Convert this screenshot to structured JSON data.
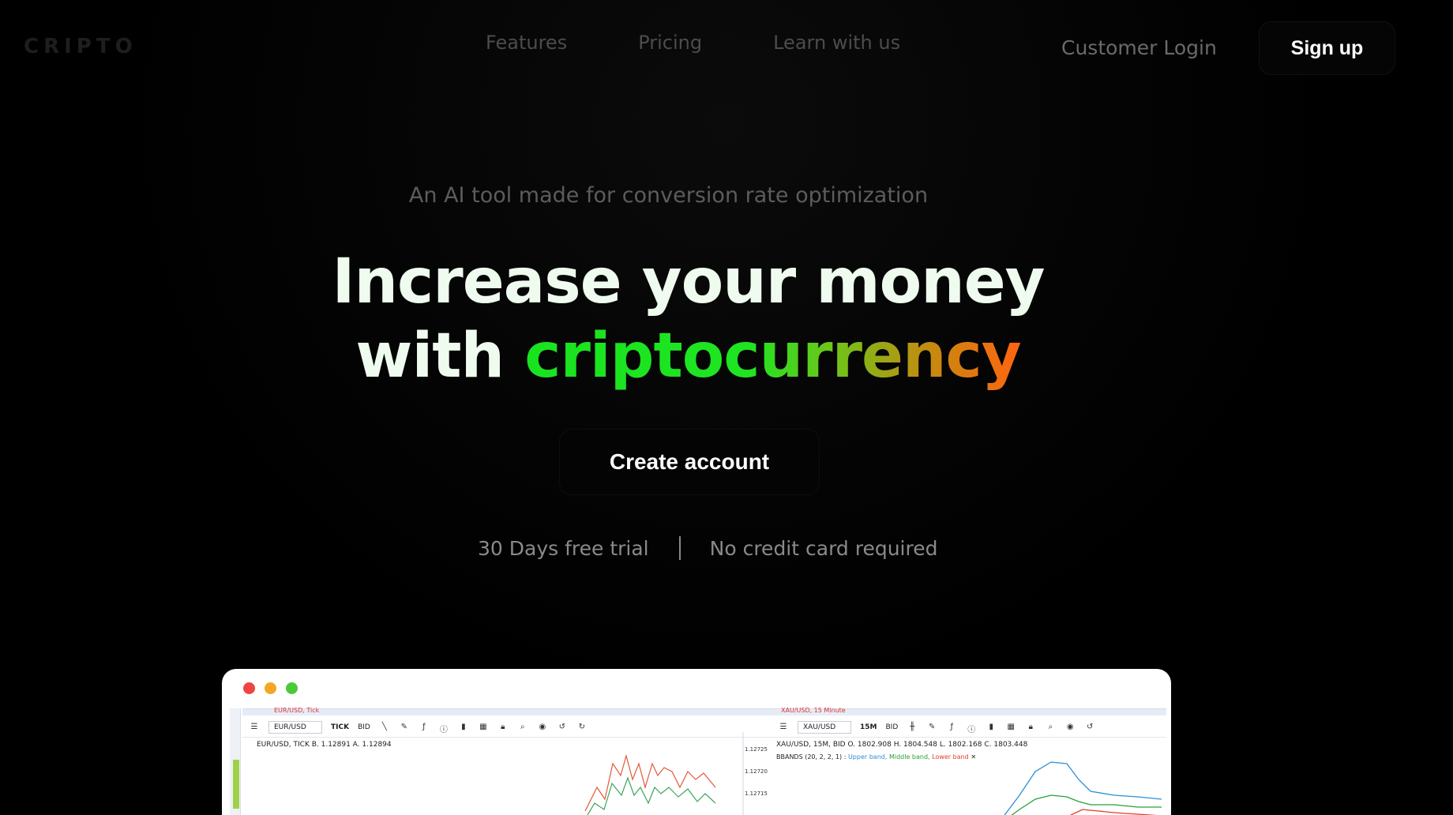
{
  "brand": {
    "logo": "CRIPTO"
  },
  "nav": {
    "links": [
      "Features",
      "Pricing",
      "Learn with us"
    ],
    "login": "Customer Login",
    "signup": "Sign up"
  },
  "hero": {
    "tagline": "An AI tool made for conversion rate optimization",
    "headline_line1": "Increase your money",
    "headline_line2_prefix": "with",
    "headline_line2_highlight": "criptocurrency",
    "cta": "Create account",
    "perk1": "30 Days free trial",
    "perk2": "No credit card required"
  },
  "colors": {
    "background": "#000000",
    "headline": "#eefbee",
    "gradient_start": "#19e31f",
    "gradient_end": "#ff6410",
    "window_dots": [
      "#ef4444",
      "#f5a623",
      "#4cc93a"
    ]
  },
  "preview": {
    "left": {
      "tab_title": "EUR/USD, Tick",
      "symbol": "EUR/USD",
      "period": "TICK",
      "side": "BID",
      "info": "EUR/USD, TICK   B. 1.12891  A. 1.12894",
      "price_labels": [
        "1.12725",
        "1.12720",
        "1.12715"
      ]
    },
    "right": {
      "tab_title": "XAU/USD, 15 Minute",
      "symbol": "XAU/USD",
      "period": "15M",
      "side": "BID",
      "info": "XAU/USD, 15M, BID   O. 1802.908  H. 1804.548  L. 1802.168  C. 1803.448",
      "indicator": "BBANDS (20, 2, 2, 1)  :",
      "band_upper": "Upper band,",
      "band_middle": "Middle band,",
      "band_lower": "Lower band"
    }
  }
}
